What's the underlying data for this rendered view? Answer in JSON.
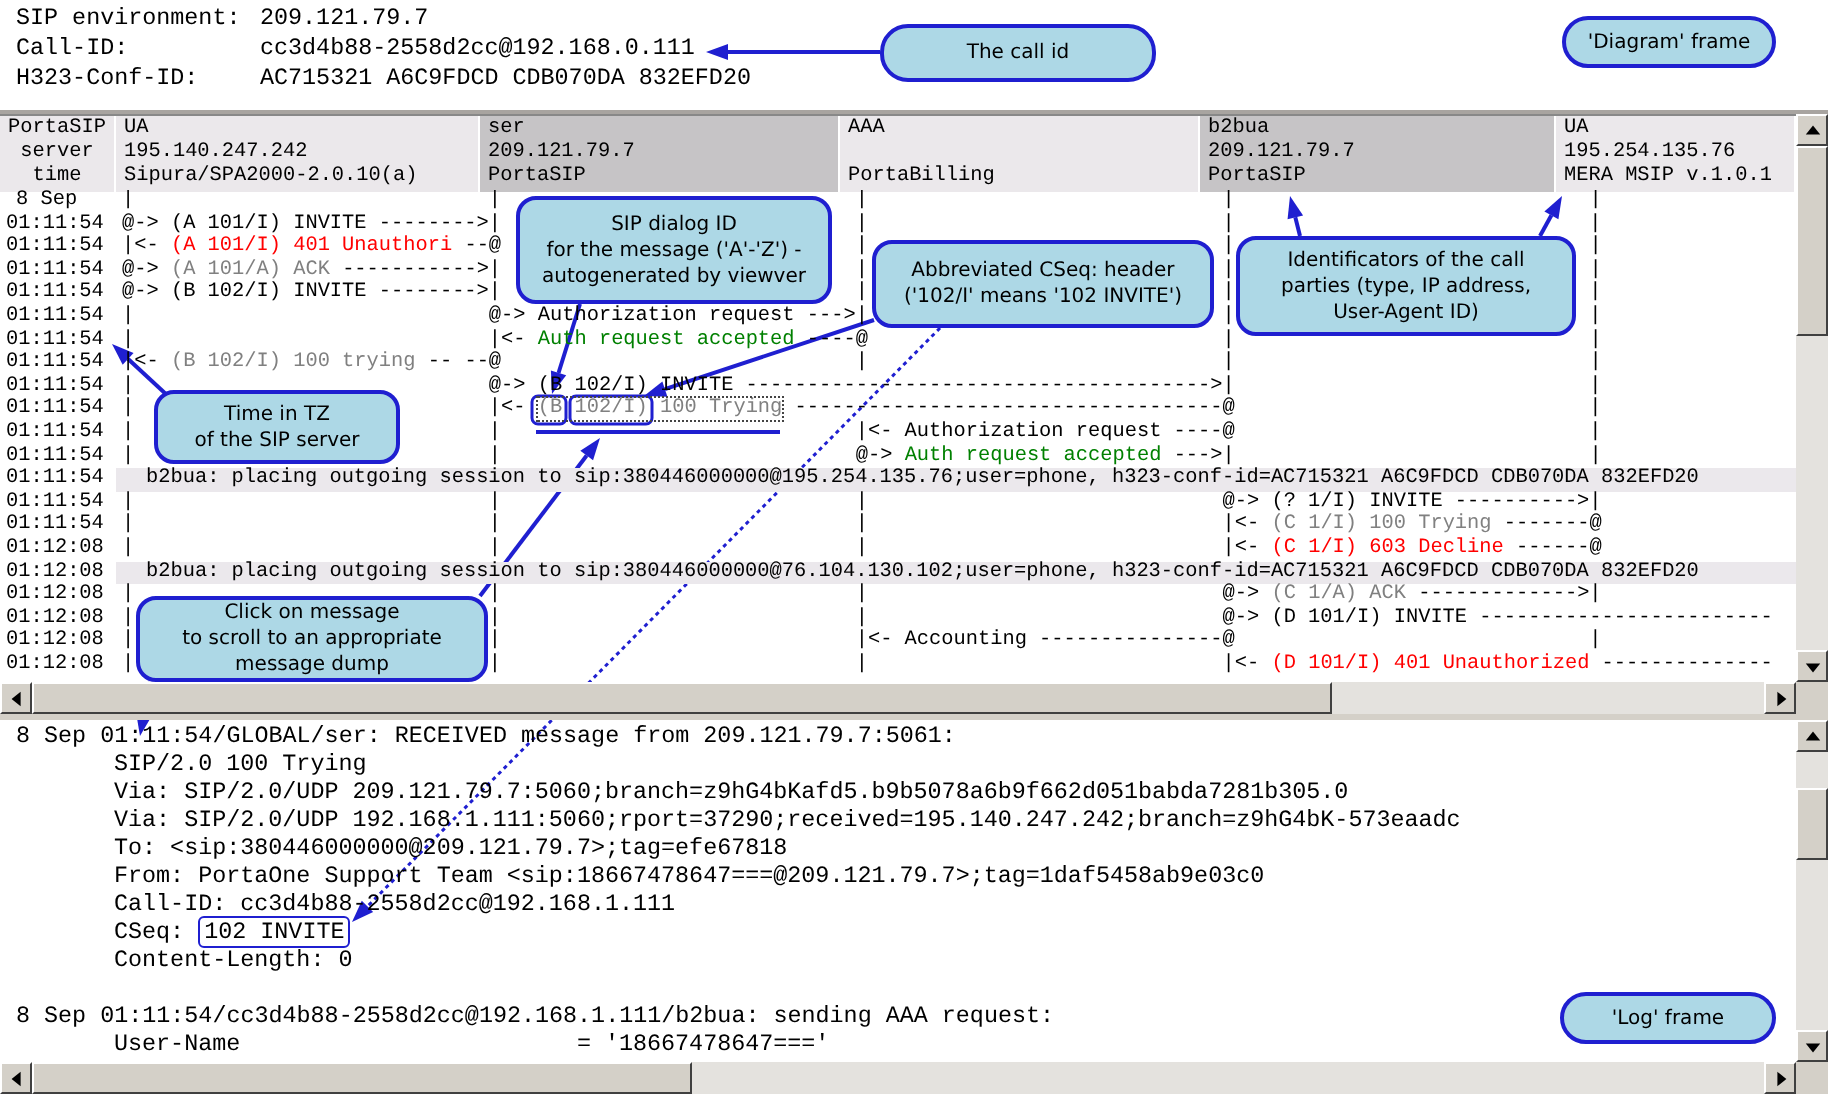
{
  "environment": [
    {
      "label": "SIP environment:",
      "value": "209.121.79.7"
    },
    {
      "label": "Call-ID:",
      "value": "cc3d4b88-2558d2cc@192.168.0.111"
    },
    {
      "label": "H323-Conf-ID:",
      "value": "AC715321 A6C9FDCD CDB070DA 832EFD20"
    }
  ],
  "diagram": {
    "time_heading": [
      "PortaSIP",
      "server",
      "time"
    ],
    "parties": [
      {
        "type": "UA",
        "address": "195.140.247.242",
        "agent": "Sipura/SPA2000-2.0.10(a)"
      },
      {
        "type": "ser",
        "address": "209.121.79.7",
        "agent": "PortaSIP"
      },
      {
        "type": "AAA",
        "agent": "PortaBilling"
      },
      {
        "type": "b2bua",
        "address": "209.121.79.7",
        "agent": "PortaSIP"
      },
      {
        "type": "UA",
        "address": "195.254.135.76",
        "agent": "MERA MSIP v.1.0.1"
      }
    ],
    "rows": [
      {
        "kind": "date",
        "time": "8 Sep",
        "parts": [
          {
            "text": "|                             |                             |                             |                             |"
          }
        ]
      },
      {
        "kind": "message",
        "time": "01:11:54",
        "selected": false,
        "parts": [
          {
            "text": "@-> (A 101/I) INVITE -------->|                             |                             |                             |"
          }
        ]
      },
      {
        "kind": "message",
        "time": "01:11:54",
        "selected": false,
        "parts": [
          {
            "text": "|<- "
          },
          {
            "text": "(A 101/I) 401 Unauthori",
            "color": "#ff0000"
          },
          {
            "text": " --@                             |                             |                             |"
          }
        ]
      },
      {
        "kind": "message",
        "time": "01:11:54",
        "selected": false,
        "parts": [
          {
            "text": "@-> "
          },
          {
            "text": "(A 101/A) ACK",
            "color": "#808080"
          },
          {
            "text": " ----------->|                             |                             |                             |"
          }
        ]
      },
      {
        "kind": "message",
        "time": "01:11:54",
        "selected": false,
        "parts": [
          {
            "text": "@-> (B 102/I) INVITE -------->|                             |                             |                             |"
          }
        ]
      },
      {
        "kind": "message",
        "time": "01:11:54",
        "selected": false,
        "parts": [
          {
            "text": "|                             @-> Authorization request --->|                             |                             |"
          }
        ]
      },
      {
        "kind": "message",
        "time": "01:11:54",
        "selected": false,
        "parts": [
          {
            "text": "|                             |<- "
          },
          {
            "text": "Auth request accepted",
            "color": "#008000"
          },
          {
            "text": " ----@                             |                             |"
          }
        ]
      },
      {
        "kind": "message",
        "time": "01:11:54",
        "selected": false,
        "parts": [
          {
            "text": "|<- "
          },
          {
            "text": "(B 102/I) 100 trying",
            "color": "#808080"
          },
          {
            "text": " -- --@                             |                             |                             |"
          }
        ]
      },
      {
        "kind": "message",
        "time": "01:11:54",
        "selected": false,
        "parts": [
          {
            "text": "|                             @-> (B 102/I) INVITE -------------------------------------->|                             |"
          }
        ]
      },
      {
        "kind": "message",
        "time": "01:11:54",
        "selected": true,
        "parts": [
          {
            "text": "|                             |<- "
          },
          {
            "text": "(B 102/I) 100 Trying",
            "color": "#808080"
          },
          {
            "text": " -----------------------------------@                             |"
          }
        ]
      },
      {
        "kind": "message",
        "time": "01:11:54",
        "selected": false,
        "parts": [
          {
            "text": "|                             |                             |<- Authorization request ----@                             |"
          }
        ]
      },
      {
        "kind": "message",
        "time": "01:11:54",
        "selected": false,
        "parts": [
          {
            "text": "|                             |                             @-> "
          },
          {
            "text": "Auth request accepted",
            "color": "#008000"
          },
          {
            "text": " --->|                             |"
          }
        ]
      },
      {
        "kind": "note",
        "time": "01:11:54",
        "text": "b2bua: placing outgoing session to sip:380446000000@195.254.135.76;user=phone, h323-conf-id=AC715321 A6C9FDCD CDB070DA 832EFD20"
      },
      {
        "kind": "message",
        "time": "01:11:54",
        "selected": false,
        "parts": [
          {
            "text": "|                             |                             |                             @-> (? 1/I) INVITE ---------->|"
          }
        ]
      },
      {
        "kind": "message",
        "time": "01:11:54",
        "selected": false,
        "parts": [
          {
            "text": "|                             |                             |                             |<- "
          },
          {
            "text": "(C 1/I) 100 Trying",
            "color": "#808080"
          },
          {
            "text": " -------@"
          }
        ]
      },
      {
        "kind": "message",
        "time": "01:12:08",
        "selected": false,
        "parts": [
          {
            "text": "|                             |                             |                             |<- "
          },
          {
            "text": "(C 1/I) 603 Decline",
            "color": "#ff0000"
          },
          {
            "text": " ------@"
          }
        ]
      },
      {
        "kind": "note",
        "time": "01:12:08",
        "text": "b2bua: placing outgoing session to sip:380446000000@76.104.130.102;user=phone, h323-conf-id=AC715321 A6C9FDCD CDB070DA 832EFD20"
      },
      {
        "kind": "message",
        "time": "01:12:08",
        "selected": false,
        "parts": [
          {
            "text": "|                             |                             |                             @-> "
          },
          {
            "text": "(C 1/A) ACK",
            "color": "#808080"
          },
          {
            "text": " ------------->|"
          }
        ]
      },
      {
        "kind": "message",
        "time": "01:12:08",
        "selected": false,
        "parts": [
          {
            "text": "|                             |                             |                             @-> (D 101/I) INVITE ------------------------"
          }
        ]
      },
      {
        "kind": "message",
        "time": "01:12:08",
        "selected": false,
        "parts": [
          {
            "text": "|                             |                             |<- Accounting ---------------@                             |"
          }
        ]
      },
      {
        "kind": "message",
        "time": "01:12:08",
        "selected": false,
        "parts": [
          {
            "text": "|                             |                             |                             |<- "
          },
          {
            "text": "(D 101/I) 401 Unauthorized",
            "color": "#ff0000"
          },
          {
            "text": " --------------"
          }
        ]
      }
    ]
  },
  "log": [
    {
      "header": "8 Sep 01:11:54/GLOBAL/ser: RECEIVED message from 209.121.79.7:5061:",
      "lines": [
        {
          "text": "SIP/2.0 100 Trying"
        },
        {
          "text": "Via: SIP/2.0/UDP 209.121.79.7:5060;branch=z9hG4bKafd5.b9b5078a6b9f662d051babda7281b305.0"
        },
        {
          "text": "Via: SIP/2.0/UDP 192.168.1.111:5060;rport=37290;received=195.140.247.242;branch=z9hG4bK-573eaadc"
        },
        {
          "text": "To: <sip:380446000000@209.121.79.7>;tag=efe67818"
        },
        {
          "text": "From: PortaOne Support Team <sip:18667478647===@209.121.79.7>;tag=1daf5458ab9e03c0"
        },
        {
          "text": "Call-ID: cc3d4b88-2558d2cc@192.168.1.111"
        },
        {
          "text": "CSeq:",
          "highlight": "102 INVITE"
        },
        {
          "text": "Content-Length: 0"
        }
      ]
    },
    {
      "header": "8 Sep 01:11:54/cc3d4b88-2558d2cc@192.168.1.111/b2bua: sending AAA request:",
      "lines": [
        {
          "text": "User-Name                        = '18667478647==='"
        }
      ]
    }
  ],
  "callouts": [
    {
      "lines": [
        "The call id"
      ]
    },
    {
      "lines": [
        "'Diagram' frame"
      ]
    },
    {
      "lines": [
        "SIP dialog ID",
        "for the message ('A'-'Z') -",
        "autogenerated by viewver"
      ]
    },
    {
      "lines": [
        "Abbreviated CSeq: header",
        "('102/I' means '102 INVITE')"
      ]
    },
    {
      "lines": [
        "Identificators of the call",
        "parties (type, IP address,",
        "User-Agent ID)"
      ]
    },
    {
      "lines": [
        "Time in TZ",
        "of the SIP server"
      ]
    },
    {
      "lines": [
        "Click on message",
        "to scroll to an appropriate",
        "message dump"
      ]
    },
    {
      "lines": [
        "'Log' frame"
      ]
    }
  ]
}
